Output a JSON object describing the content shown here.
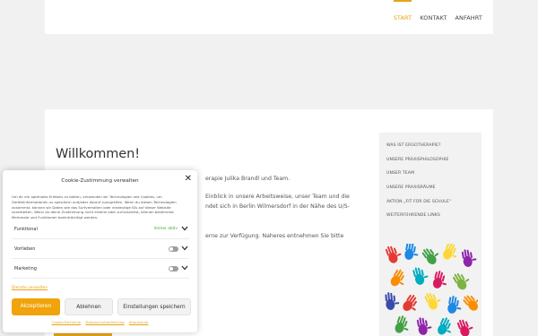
{
  "nav": {
    "items": [
      "START",
      "KONTAKT",
      "ANFAHRT"
    ],
    "active": "START"
  },
  "main": {
    "title": "Willkommen!",
    "paragraphs": [
      "erapie Julika Brandl und Team.",
      "Einblick in unsere Arbeitsweise, unser Team und die",
      "ndet sich in Berlin Wilmersdorf in der Nähe des U/S-",
      "erne zur Verfügung. Naheres entnehmen Sie bitte"
    ]
  },
  "sidebar": {
    "items": [
      "WAS IST ERGOTHERAPIE?",
      "UNSERE PRAXISPHILOSOPHIE",
      "UNSER TEAM",
      "UNSERE PRAXISRÄUME",
      "AKTION „FIT FÜR DIE SCHULE“",
      "WEITERFÜHRENDE LINKS"
    ]
  },
  "cookie": {
    "title": "Cookie-Zustimmung verwalten",
    "description": "Um dir ein optimales Erlebnis zu bieten, verwenden wir Technologien wie Cookies, um Geräteinformationen zu speichern und/oder darauf zuzugreifen. Wenn du diesen Technologien zustimmst, können wir Daten wie das Surfverhalten oder eindeutige IDs auf dieser Website verarbeiten. Wenn du deine Zustimmung nicht erteilst oder zurückziehst, können bestimmte Merkmale und Funktionen beeinträchtigt werden.",
    "categories": [
      {
        "label": "Funktional",
        "status": "Immer aktiv"
      },
      {
        "label": "Vorlieben"
      },
      {
        "label": "Marketing"
      }
    ],
    "preferences_link": "Dienste verwalten",
    "accept": "Akzeptieren",
    "deny": "Ablehnen",
    "save": "Einstellungen speichern",
    "footer_links": [
      "Cookie-Richtlinie",
      "Datenschutzerklärung",
      "Impressum"
    ],
    "accent_color": "#f0a30a"
  }
}
